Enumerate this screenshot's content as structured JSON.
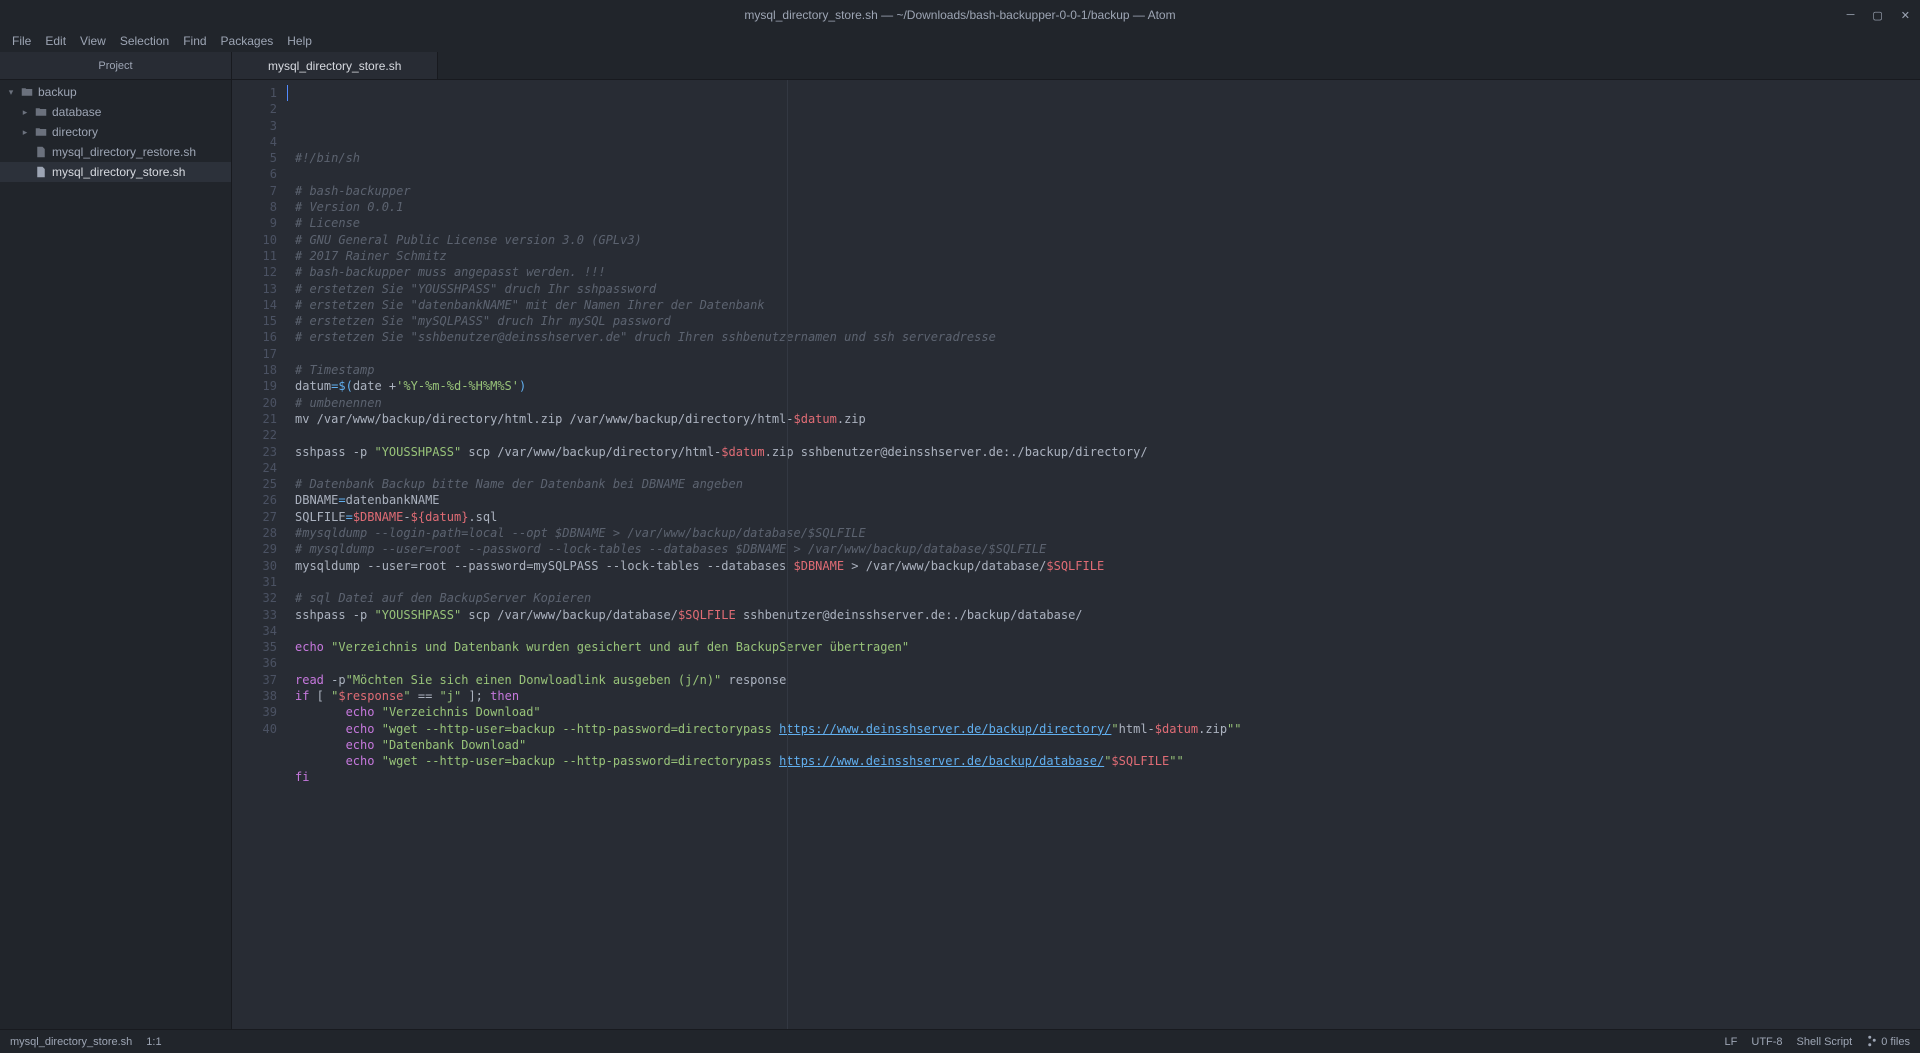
{
  "title": "mysql_directory_store.sh — ~/Downloads/bash-backupper-0-0-1/backup — Atom",
  "menu": [
    "File",
    "Edit",
    "View",
    "Selection",
    "Find",
    "Packages",
    "Help"
  ],
  "sidebar": {
    "header": "Project",
    "tree": {
      "root": "backup",
      "folders": [
        "database",
        "directory"
      ],
      "files": [
        "mysql_directory_restore.sh",
        "mysql_directory_store.sh"
      ]
    }
  },
  "tabs": [
    {
      "label": "mysql_directory_store.sh",
      "active": true
    }
  ],
  "status": {
    "file": "mysql_directory_store.sh",
    "cursor": "1:1",
    "eol": "LF",
    "encoding": "UTF-8",
    "grammar": "Shell Script",
    "git": "0 files"
  },
  "code": {
    "lines": [
      [
        [
          "c-comment",
          "#!/bin/sh"
        ]
      ],
      [],
      [
        [
          "c-comment",
          "# bash-backupper"
        ]
      ],
      [
        [
          "c-comment",
          "# Version 0.0.1"
        ]
      ],
      [
        [
          "c-comment",
          "# License"
        ]
      ],
      [
        [
          "c-comment",
          "# GNU General Public License version 3.0 (GPLv3)"
        ]
      ],
      [
        [
          "c-comment",
          "# 2017 Rainer Schmitz"
        ]
      ],
      [
        [
          "c-comment",
          "# bash-backupper muss angepasst werden. !!!"
        ]
      ],
      [
        [
          "c-comment",
          "# erstetzen Sie \"YOUSSHPASS\" druch Ihr sshpassword"
        ]
      ],
      [
        [
          "c-comment",
          "# erstetzen Sie \"datenbankNAME\" mit der Namen Ihrer der Datenbank"
        ]
      ],
      [
        [
          "c-comment",
          "# erstetzen Sie \"mySQLPASS\" druch Ihr mySQL password"
        ]
      ],
      [
        [
          "c-comment",
          "# erstetzen Sie \"sshbenutzer@deinsshserver.de\" druch Ihren sshbenutzernamen und ssh serveradresse"
        ]
      ],
      [],
      [
        [
          "c-comment",
          "# Timestamp"
        ]
      ],
      [
        [
          "c-text",
          "datum"
        ],
        [
          "c-op",
          "="
        ],
        [
          "c-op",
          "$("
        ],
        [
          "c-text",
          "date +"
        ],
        [
          "c-str",
          "'%Y-%m-%d-%H%M%S'"
        ],
        [
          "c-op",
          ")"
        ]
      ],
      [
        [
          "c-comment",
          "# umbenennen"
        ]
      ],
      [
        [
          "c-text",
          "mv /var/www/backup/directory/html.zip /var/www/backup/directory/html-"
        ],
        [
          "c-var",
          "$datum"
        ],
        [
          "c-text",
          ".zip"
        ]
      ],
      [],
      [
        [
          "c-text",
          "sshpass -p "
        ],
        [
          "c-str",
          "\"YOUSSHPASS\""
        ],
        [
          "c-text",
          " scp /var/www/backup/directory/html-"
        ],
        [
          "c-var",
          "$datum"
        ],
        [
          "c-text",
          ".zip sshbenutzer@deinsshserver.de:./backup/directory/"
        ]
      ],
      [],
      [
        [
          "c-comment",
          "# Datenbank Backup bitte Name der Datenbank bei DBNAME angeben"
        ]
      ],
      [
        [
          "c-text",
          "DBNAME"
        ],
        [
          "c-op",
          "="
        ],
        [
          "c-text",
          "datenbankNAME"
        ]
      ],
      [
        [
          "c-text",
          "SQLFILE"
        ],
        [
          "c-op",
          "="
        ],
        [
          "c-var",
          "$DBNAME"
        ],
        [
          "c-text",
          "-"
        ],
        [
          "c-var",
          "${datum}"
        ],
        [
          "c-text",
          ".sql"
        ]
      ],
      [
        [
          "c-comment",
          "#mysqldump --login-path=local --opt $DBNAME > /var/www/backup/database/$SQLFILE"
        ]
      ],
      [
        [
          "c-comment",
          "# mysqldump --user=root --password --lock-tables --databases $DBNAME > /var/www/backup/database/$SQLFILE"
        ]
      ],
      [
        [
          "c-text",
          "mysqldump --user=root --password=mySQLPASS --lock-tables --databases "
        ],
        [
          "c-var",
          "$DBNAME"
        ],
        [
          "c-text",
          " > /var/www/backup/database/"
        ],
        [
          "c-var",
          "$SQLFILE"
        ]
      ],
      [],
      [
        [
          "c-comment",
          "# sql Datei auf den BackupServer Kopieren"
        ]
      ],
      [
        [
          "c-text",
          "sshpass -p "
        ],
        [
          "c-str",
          "\"YOUSSHPASS\""
        ],
        [
          "c-text",
          " scp /var/www/backup/database/"
        ],
        [
          "c-var",
          "$SQLFILE"
        ],
        [
          "c-text",
          " sshbenutzer@deinsshserver.de:./backup/database/"
        ]
      ],
      [],
      [
        [
          "c-key",
          "echo"
        ],
        [
          "c-text",
          " "
        ],
        [
          "c-str",
          "\"Verzeichnis und Datenbank wurden gesichert und auf den BackupServer übertragen\""
        ]
      ],
      [],
      [
        [
          "c-key",
          "read"
        ],
        [
          "c-text",
          " -p"
        ],
        [
          "c-str",
          "\"Möchten Sie sich einen Donwloadlink ausgeben (j/n)\""
        ],
        [
          "c-text",
          " response"
        ]
      ],
      [
        [
          "c-key",
          "if"
        ],
        [
          "c-text",
          " [ "
        ],
        [
          "c-str",
          "\""
        ],
        [
          "c-var",
          "$response"
        ],
        [
          "c-str",
          "\""
        ],
        [
          "c-text",
          " == "
        ],
        [
          "c-str",
          "\"j\""
        ],
        [
          "c-text",
          " ]; "
        ],
        [
          "c-key",
          "then"
        ]
      ],
      [
        [
          "c-text",
          "       "
        ],
        [
          "c-key",
          "echo"
        ],
        [
          "c-text",
          " "
        ],
        [
          "c-str",
          "\"Verzeichnis Download\""
        ]
      ],
      [
        [
          "c-text",
          "       "
        ],
        [
          "c-key",
          "echo"
        ],
        [
          "c-text",
          " "
        ],
        [
          "c-str",
          "\"wget --http-user=backup --http-password=directorypass "
        ],
        [
          "c-link",
          "https://www.deinsshserver.de/backup/directory/"
        ],
        [
          "c-str",
          "\""
        ],
        [
          "c-text",
          "html-"
        ],
        [
          "c-var",
          "$datum"
        ],
        [
          "c-text",
          ".zip"
        ],
        [
          "c-str",
          "\"\""
        ]
      ],
      [
        [
          "c-text",
          "       "
        ],
        [
          "c-key",
          "echo"
        ],
        [
          "c-text",
          " "
        ],
        [
          "c-str",
          "\"Datenbank Download\""
        ]
      ],
      [
        [
          "c-text",
          "       "
        ],
        [
          "c-key",
          "echo"
        ],
        [
          "c-text",
          " "
        ],
        [
          "c-str",
          "\"wget --http-user=backup --http-password=directorypass "
        ],
        [
          "c-link",
          "https://www.deinsshserver.de/backup/database/"
        ],
        [
          "c-str",
          "\""
        ],
        [
          "c-var",
          "$SQLFILE"
        ],
        [
          "c-str",
          "\"\""
        ]
      ],
      [
        [
          "c-key",
          "fi"
        ]
      ],
      []
    ]
  }
}
